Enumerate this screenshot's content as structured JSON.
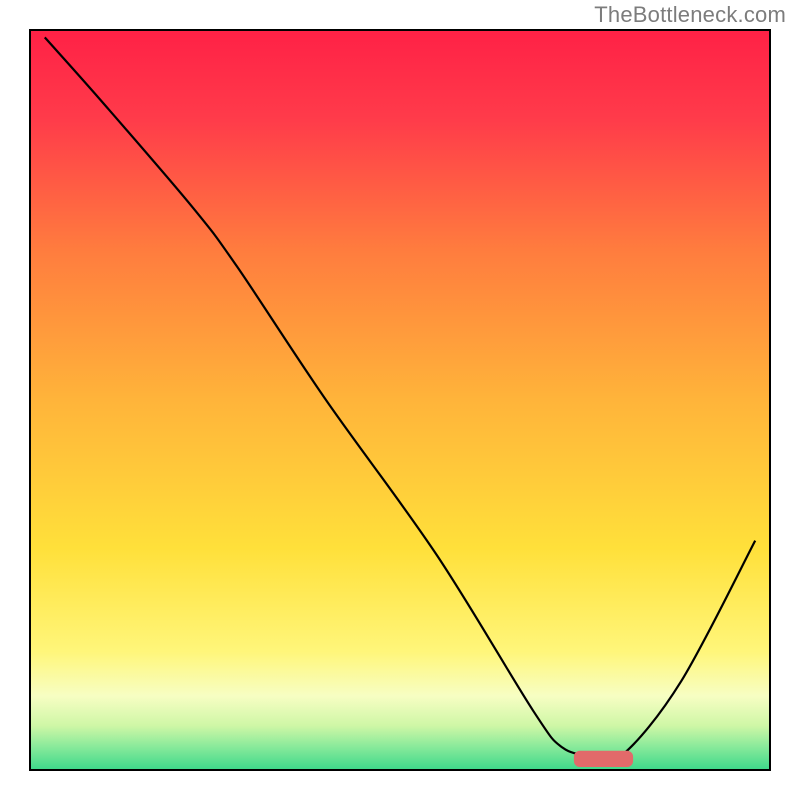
{
  "watermark": "TheBottleneck.com",
  "chart_data": {
    "type": "line",
    "title": "",
    "xlabel": "",
    "ylabel": "",
    "xlim": [
      0,
      100
    ],
    "ylim": [
      0,
      100
    ],
    "axes_visible": false,
    "grid": false,
    "background": {
      "type": "vertical-gradient",
      "stops": [
        {
          "offset": 0.0,
          "color": "#ff2146"
        },
        {
          "offset": 0.12,
          "color": "#ff3b4a"
        },
        {
          "offset": 0.3,
          "color": "#ff7d3e"
        },
        {
          "offset": 0.5,
          "color": "#ffb43a"
        },
        {
          "offset": 0.7,
          "color": "#ffe03a"
        },
        {
          "offset": 0.84,
          "color": "#fff67a"
        },
        {
          "offset": 0.9,
          "color": "#f7fec3"
        },
        {
          "offset": 0.94,
          "color": "#cff7a6"
        },
        {
          "offset": 0.97,
          "color": "#85e99a"
        },
        {
          "offset": 1.0,
          "color": "#3dd88a"
        }
      ]
    },
    "series": [
      {
        "name": "bottleneck-curve",
        "color": "#000000",
        "stroke_width": 2.2,
        "x": [
          2,
          10,
          22,
          28,
          40,
          55,
          68,
          72,
          76,
          80,
          88,
          98
        ],
        "y": [
          99,
          90,
          76,
          68,
          50,
          29,
          8,
          3,
          2,
          2,
          12,
          31
        ]
      }
    ],
    "markers": [
      {
        "name": "optimal-range-marker",
        "shape": "rounded-rect",
        "color": "#e26a6a",
        "x_center": 77.5,
        "y_center": 1.5,
        "width": 8,
        "height": 2.2
      }
    ],
    "frame": {
      "visible": true,
      "color": "#000000",
      "stroke_width": 2
    }
  }
}
